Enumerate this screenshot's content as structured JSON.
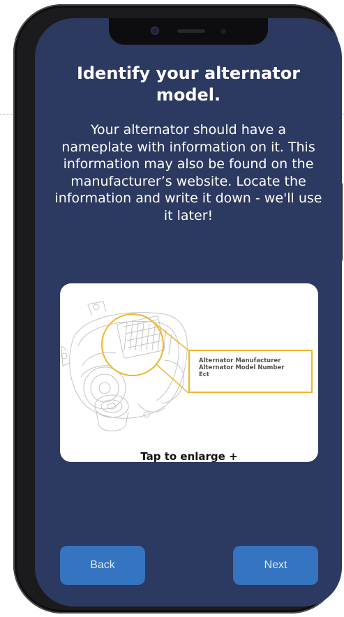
{
  "screen": {
    "title": "Identify your alternator model.",
    "instructions": "Your alternator should have a nameplate with information on it. This information may also be found on the manufacturer’s website. Locate the information and write it down - we'll use it later!"
  },
  "image_card": {
    "callout_lines": [
      "Alternator Manufacturer",
      "Alternator Model Number",
      "Ect"
    ],
    "tap_label": "Tap to enlarge +",
    "illustration_icon": "alternator-line-drawing"
  },
  "footer": {
    "back_label": "Back",
    "next_label": "Next"
  },
  "colors": {
    "screen_background": "#2c3961",
    "button_background": "#3474c0",
    "callout_highlight": "#f0b62b",
    "text": "#ffffff"
  }
}
